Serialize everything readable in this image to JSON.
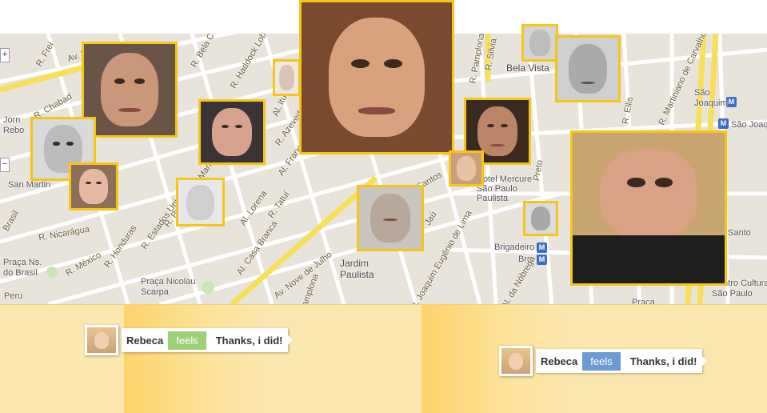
{
  "map": {
    "zoom_in": "+",
    "zoom_out": "−",
    "labels": {
      "bela_vista": "Bela Vista",
      "jardim_paulista": "Jardim\nPaulista",
      "hotel": "Hotel Mercure\nSão Paulo\nPaulista",
      "brigadeiro": "Brigadeiro",
      "brg": "Brg",
      "praca_brasil": "Praça Ns.\ndo Brasil",
      "praca_nicolau": "Praça Nicolau\nScarpa",
      "san_martin": "San Martin",
      "jorn_rebo": "Jorn\nRebo",
      "sao_joaquim": "São\nJoaquim",
      "sao_joaquim_2": "São Joaquim",
      "centro_cultura": "Centro Cultura\nSão Paulo",
      "santo": "Santo",
      "praca": "Praça"
    },
    "roads": {
      "av_nove_julho": "Av. Nove de Julho",
      "r_frei": "R. Frei",
      "r_chabad": "R. Chabad",
      "av_r": "Av. R",
      "r_bela_c": "R. Bela C",
      "r_haddock": "R. Haddock Lobo",
      "r_pamplona": "R. Pamplona",
      "r_silvia": "R. Silvia",
      "r_ellis": "R. Ellis",
      "r_martiniano": "R. Martiniano de Carvalho",
      "al_santos": "Al. Santos",
      "al_franca": "Al. Franca",
      "al_itu": "Al. Itu",
      "al_lorena": "Al. Lorena",
      "al_tatui": "R. Tatuí",
      "al_casa_branca": "Al. Casa Branca",
      "r_padre": "R. Padre João Manuel",
      "r_estados": "R. Estados Unidos",
      "r_honduras": "R. Honduras",
      "r_nicaragua": "R. Nicarágua",
      "r_mexico": "R. México",
      "r_peru": "Peru",
      "brasil": "Brasil",
      "al_j_eug": "Al. Joaquim Eugênio de Lima",
      "al_jau": "Jaú",
      "al_nobrega": "Al. da Nóbrega",
      "r_azevedo": "R. Azevedo",
      "preto": "Preto",
      "pamplona2": "Pamplona"
    },
    "metro_glyph": "M"
  },
  "feed": {
    "posts": [
      {
        "name": "Rebeca",
        "verb": "feels",
        "verb_color": "#9ed07a",
        "text": "Thanks, i did!"
      },
      {
        "name": "Rebeca",
        "verb": "feels",
        "verb_color": "#6b9bd2",
        "text": "Thanks, i did!"
      }
    ]
  },
  "colors": {
    "photo_border": "#f5c518",
    "strip": "#fde7b0",
    "band_dark": "#fdd36a",
    "highway": "#f7df5a"
  }
}
